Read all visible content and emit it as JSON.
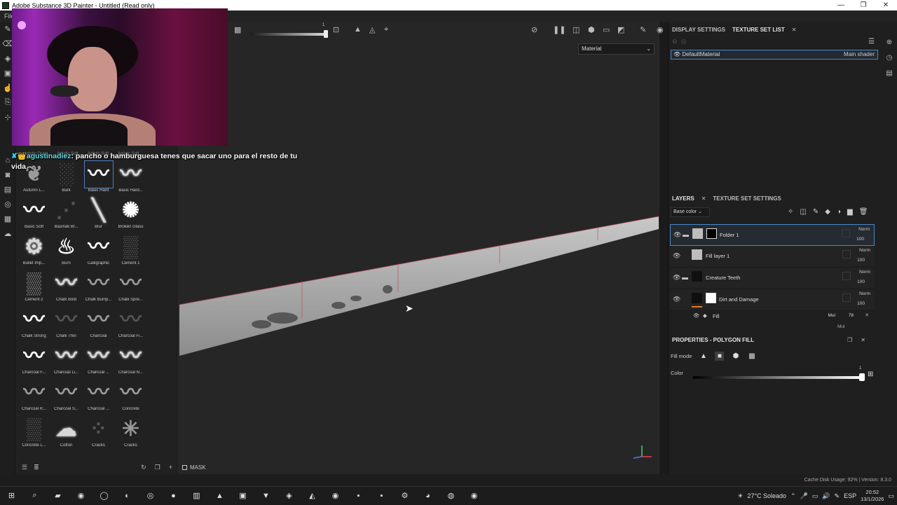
{
  "window": {
    "title": "Adobe Substance 3D Painter - Untitled (Read only)",
    "controls": [
      "—",
      "❐",
      "✕"
    ]
  },
  "menu": {
    "first_item": "File"
  },
  "shelf": {
    "top_labels": [
      "Artistic Dram...",
      "Artistic Soft...",
      "Artistic Soft...",
      "Artistic Soft..."
    ],
    "brushes": [
      {
        "name": "Autumn L...",
        "glyph": "❦",
        "style": "dim"
      },
      {
        "name": "Bark",
        "glyph": "░",
        "style": "faint"
      },
      {
        "name": "Basic Hard",
        "glyph": "〰",
        "style": "bright",
        "selected": true
      },
      {
        "name": "Basic Hard...",
        "glyph": "〰",
        "style": "soft"
      },
      {
        "name": "Basic Soft",
        "glyph": "〰",
        "style": "bright"
      },
      {
        "name": "Basmati Br...",
        "glyph": "⋰",
        "style": "faint"
      },
      {
        "name": "Blur",
        "glyph": "╲",
        "style": "soft"
      },
      {
        "name": "Broken Glass",
        "glyph": "✺",
        "style": "bright"
      },
      {
        "name": "Bullet Imp...",
        "glyph": "⚙",
        "style": "soft"
      },
      {
        "name": "Burn",
        "glyph": "♨",
        "style": "bright"
      },
      {
        "name": "Calligraphic",
        "glyph": "〰",
        "style": "bright"
      },
      {
        "name": "Cement 1",
        "glyph": "▒",
        "style": "faint"
      },
      {
        "name": "Cement 2",
        "glyph": "▒",
        "style": "dim"
      },
      {
        "name": "Chalk Bold",
        "glyph": "〰",
        "style": "soft"
      },
      {
        "name": "Chalk Bump...",
        "glyph": "〰",
        "style": "dim"
      },
      {
        "name": "Chalk Spre...",
        "glyph": "〰",
        "style": "dim"
      },
      {
        "name": "Chalk Strong",
        "glyph": "〰",
        "style": "bright"
      },
      {
        "name": "Chalk Thin",
        "glyph": "〰",
        "style": "faint"
      },
      {
        "name": "Charcoal",
        "glyph": "〰",
        "style": "dim"
      },
      {
        "name": "Charcoal Fi...",
        "glyph": "〰",
        "style": "faint"
      },
      {
        "name": "Charcoal F...",
        "glyph": "〰",
        "style": "bright"
      },
      {
        "name": "Charcoal Li...",
        "glyph": "〰",
        "style": "soft"
      },
      {
        "name": "Charcoal ...",
        "glyph": "〰",
        "style": "soft"
      },
      {
        "name": "Charcoal N...",
        "glyph": "〰",
        "style": "soft"
      },
      {
        "name": "Charcoal R...",
        "glyph": "〰",
        "style": "dim"
      },
      {
        "name": "Charcoal S...",
        "glyph": "〰",
        "style": "dim"
      },
      {
        "name": "Charcoal ...",
        "glyph": "〰",
        "style": "dim"
      },
      {
        "name": "Concrete",
        "glyph": "〰",
        "style": "dim"
      },
      {
        "name": "Concrete L...",
        "glyph": "▒",
        "style": "faint"
      },
      {
        "name": "Cotton",
        "glyph": "☁",
        "style": "soft"
      },
      {
        "name": "Cracks",
        "glyph": "⁘",
        "style": "faint"
      },
      {
        "name": "Cracks",
        "glyph": "✳",
        "style": "dim"
      }
    ]
  },
  "viewport": {
    "material_mode": "Material",
    "slider_value": "1",
    "mask_label": "MASK"
  },
  "chat": {
    "username": "agustinadiez",
    "message": ": pancho o hamburguesa tenes que sacar uno para el resto de tu vida"
  },
  "right_panel": {
    "top_tabs": {
      "display_settings": "DISPLAY SETTINGS",
      "texture_set_list": "TEXTURE SET LIST"
    },
    "texture_set": {
      "name": "DefaultMaterial",
      "shader": "Main shader"
    },
    "layer_tabs": {
      "layers": "LAYERS",
      "texture_set_settings": "TEXTURE SET SETTINGS"
    },
    "channel": "Base color",
    "layers": [
      {
        "name": "Folder 1",
        "mode": "Norm",
        "opacity": "100",
        "type": "folder",
        "selected": true
      },
      {
        "name": "Fill layer 1",
        "mode": "Norm",
        "opacity": "100",
        "type": "fill"
      },
      {
        "name": "Creature Teeth",
        "mode": "Norm",
        "opacity": "100",
        "type": "folder"
      },
      {
        "name": "Dirt and Damage",
        "mode": "Norm",
        "opacity": "100",
        "type": "layer"
      }
    ],
    "fill_effect": {
      "name": "Fill",
      "mode": "Mul",
      "opacity": "78"
    },
    "next_row_mode": "Mul",
    "properties": {
      "title": "PROPERTIES - POLYGON FILL",
      "fill_mode_label": "Fill mode",
      "color_label": "Color",
      "color_value": "1"
    }
  },
  "status": {
    "text": "Cache Disk Usage:  92%  |  Version: 8.3.0"
  },
  "taskbar": {
    "weather": "27°C  Soleado",
    "lang": "ESP",
    "time": "20:52",
    "date": "13/1/2026"
  }
}
